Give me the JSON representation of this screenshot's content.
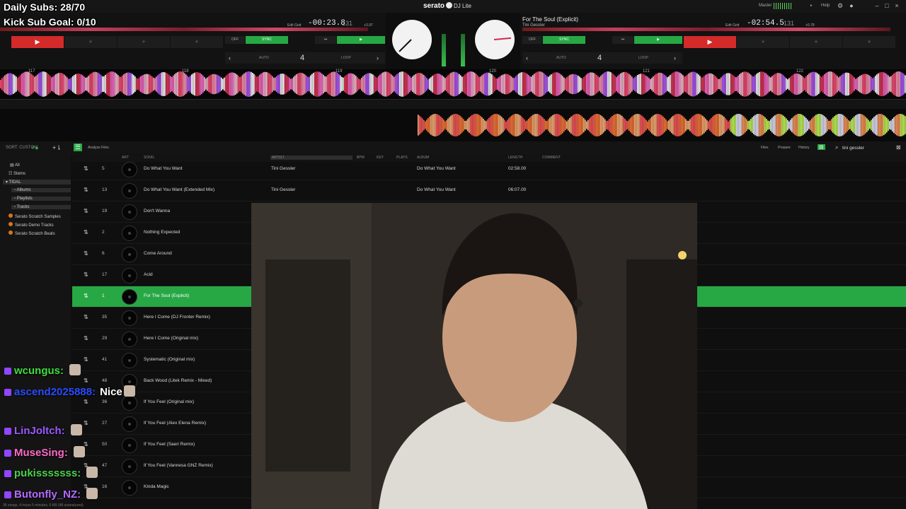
{
  "app": {
    "brand": "serato",
    "product": "DJ Lite"
  },
  "overlay": {
    "daily_subs": "Daily Subs: 28/70",
    "kick_goal": "Kick Sub Goal: 0/10"
  },
  "topbar": {
    "master_label": "Master",
    "help_label": "Help",
    "deck_number": "2"
  },
  "deck_left": {
    "time": "-00:23.8",
    "bpm": "131",
    "edit_grid": "Edit Grid",
    "pitch": "+3.97",
    "off": "OFF",
    "sync": "SYNC",
    "auto": "AUTO",
    "loop_size": "4",
    "loop": "LOOP",
    "play_icon": "play-icon"
  },
  "deck_right": {
    "title": "For The Soul (Explicit)",
    "artist": "Tini Gessler",
    "time": "-02:54.5",
    "bpm": "131",
    "edit_grid": "Edit Grid",
    "pitch": "+0.78",
    "off": "OFF",
    "sync": "SYNC",
    "auto": "AUTO",
    "loop_size": "4",
    "loop": "LOOP"
  },
  "waveform": {
    "markers": [
      "117",
      "118",
      "119",
      "120",
      "121",
      "122"
    ]
  },
  "library": {
    "analyze_label": "Analyze Files",
    "files_tab": "Files",
    "prepare_tab": "Prepare",
    "history_tab": "History",
    "search_value": "tini gessler",
    "sort_label": "SORT: CUSTOM",
    "status": "35 songs, 4 hours 5 minutes, 0 KB (48 unanalyzed)",
    "columns": {
      "art": "ART",
      "song": "SONG",
      "artist": "ARTIST",
      "bpm": "BPM",
      "key": "KEY",
      "plays": "PLAYS",
      "album": "ALBUM",
      "length": "LENGTH",
      "comment": "COMMENT"
    }
  },
  "sidebar": {
    "items": [
      {
        "label": "All"
      },
      {
        "label": "Stems"
      },
      {
        "label": "TIDAL"
      },
      {
        "label": "Albums"
      },
      {
        "label": "Playlists"
      },
      {
        "label": "Tracks"
      },
      {
        "label": "Serato Scratch Samples"
      },
      {
        "label": "Serato Demo Tracks"
      },
      {
        "label": "Serato Scratch Beats"
      }
    ]
  },
  "tracks": [
    {
      "idx": "5",
      "song": "Do What You Want",
      "artist": "Tini Gessler",
      "album": "Do What You Want",
      "length": "02:58.00"
    },
    {
      "idx": "13",
      "song": "Do What You Want (Extended Mix)",
      "artist": "Tini Gessler",
      "album": "Do What You Want",
      "length": "06:07.00"
    },
    {
      "idx": "19",
      "song": "Don't Wanna"
    },
    {
      "idx": "2",
      "song": "Nothing Expected"
    },
    {
      "idx": "6",
      "song": "Come Around"
    },
    {
      "idx": "17",
      "song": "Acid"
    },
    {
      "idx": "1",
      "song": "For The Soul (Explicit)"
    },
    {
      "idx": "35",
      "song": "Here I Come (DJ Fronter Remix)"
    },
    {
      "idx": "29",
      "song": "Here I Come (Original mix)"
    },
    {
      "idx": "41",
      "song": "Systematic (Original mix)"
    },
    {
      "idx": "48",
      "song": "Back Wood (Litek Remix - Mixed)"
    },
    {
      "idx": "36",
      "song": "If You Feel (Original mix)"
    },
    {
      "idx": "27",
      "song": "If You Feel (Alex Elena Remix)"
    },
    {
      "idx": "50",
      "song": "If You Feel (Saeri Remix)"
    },
    {
      "idx": "47",
      "song": "If You Feel (Vannesa GNZ Remix)"
    },
    {
      "idx": "16",
      "song": "Kinda Magic"
    }
  ],
  "chat": [
    {
      "user": "wcungus:",
      "color": "#3fdc3f",
      "msg": ""
    },
    {
      "user": "ascend2025888:",
      "color": "#2a4cff",
      "msg": "Nice"
    },
    {
      "user": "LinJoltch:",
      "color": "#9b59ff",
      "msg": ""
    },
    {
      "user": "MuseSing:",
      "color": "#ff69c8",
      "msg": ""
    },
    {
      "user": "pukisssssss:",
      "color": "#4bd14b",
      "msg": ""
    },
    {
      "user": "Butonfly_NZ:",
      "color": "#b46bff",
      "msg": ""
    }
  ],
  "colors": {
    "accent_green": "#27a844",
    "cue_red": "#d42a2a",
    "serato_orange": "#d8731d"
  }
}
